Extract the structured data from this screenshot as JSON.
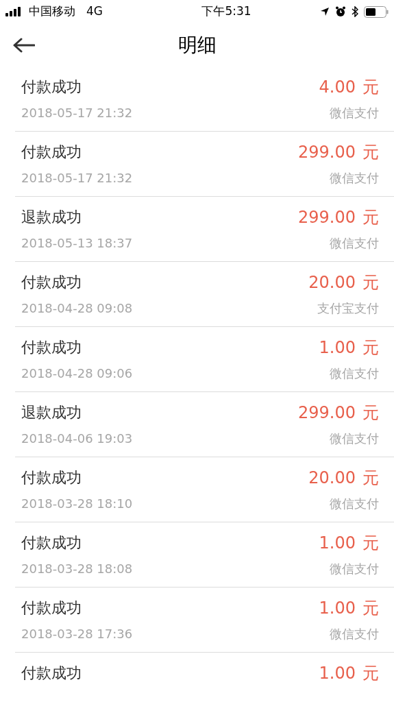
{
  "status_bar": {
    "carrier": "中国移动",
    "network": "4G",
    "time": "下午5:31"
  },
  "nav": {
    "title": "明细"
  },
  "records": [
    {
      "status": "付款成功",
      "date": "2018-05-17 21:32",
      "amount": "4.00",
      "unit": "元",
      "method": "微信支付"
    },
    {
      "status": "付款成功",
      "date": "2018-05-17 21:32",
      "amount": "299.00",
      "unit": "元",
      "method": "微信支付"
    },
    {
      "status": "退款成功",
      "date": "2018-05-13 18:37",
      "amount": "299.00",
      "unit": "元",
      "method": "微信支付"
    },
    {
      "status": "付款成功",
      "date": "2018-04-28 09:08",
      "amount": "20.00",
      "unit": "元",
      "method": "支付宝支付"
    },
    {
      "status": "付款成功",
      "date": "2018-04-28 09:06",
      "amount": "1.00",
      "unit": "元",
      "method": "微信支付"
    },
    {
      "status": "退款成功",
      "date": "2018-04-06 19:03",
      "amount": "299.00",
      "unit": "元",
      "method": "微信支付"
    },
    {
      "status": "付款成功",
      "date": "2018-03-28 18:10",
      "amount": "20.00",
      "unit": "元",
      "method": "微信支付"
    },
    {
      "status": "付款成功",
      "date": "2018-03-28 18:08",
      "amount": "1.00",
      "unit": "元",
      "method": "微信支付"
    },
    {
      "status": "付款成功",
      "date": "2018-03-28 17:36",
      "amount": "1.00",
      "unit": "元",
      "method": "微信支付"
    },
    {
      "status": "付款成功",
      "amount": "1.00",
      "unit": "元"
    }
  ]
}
